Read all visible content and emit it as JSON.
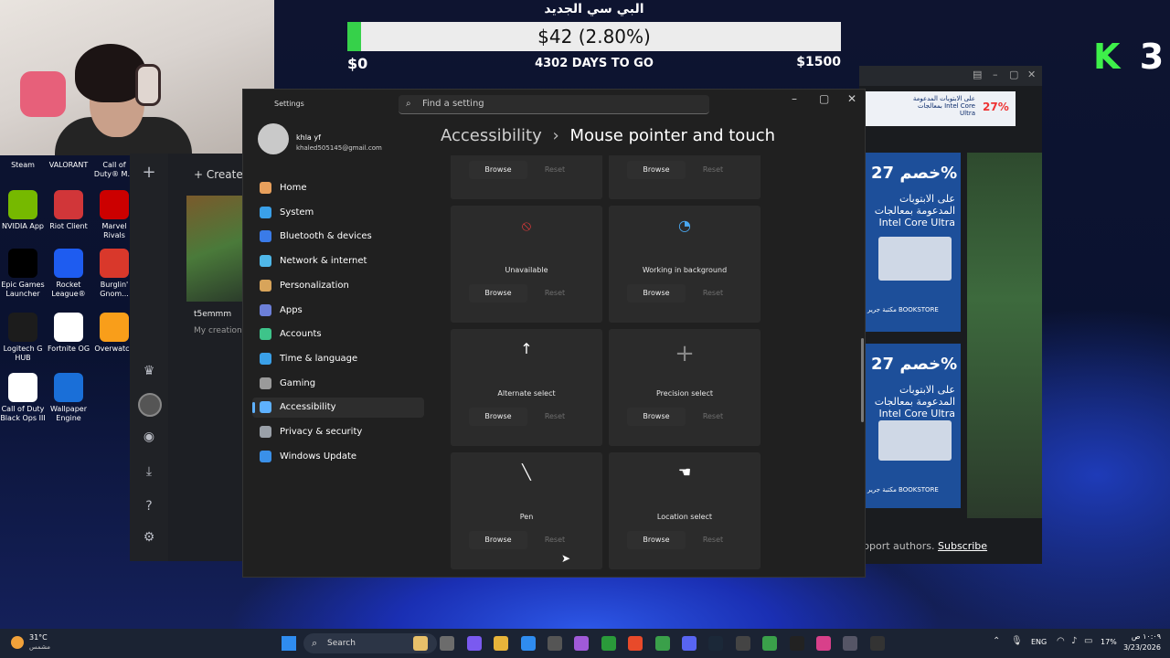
{
  "donation": {
    "title": "البي سي الجديد",
    "amount_text": "$42 (2.80%)",
    "progress_fraction": 0.028,
    "start_label": "$0",
    "days_label": "4302 DAYS TO GO",
    "goal_label": "$1500"
  },
  "brand": {
    "letter": "K",
    "number": "3"
  },
  "desktop_icons": [
    {
      "label": "Steam"
    },
    {
      "label": "VALORANT"
    },
    {
      "label": "Call of Duty® M..."
    },
    {
      "label": "NVIDIA App"
    },
    {
      "label": "Riot Client"
    },
    {
      "label": "Marvel Rivals"
    },
    {
      "label": "Epic Games Launcher"
    },
    {
      "label": "Rocket League®"
    },
    {
      "label": "Burglin' Gnom..."
    },
    {
      "label": "Logitech G HUB"
    },
    {
      "label": "Fortnite OG"
    },
    {
      "label": "Overwatch"
    },
    {
      "label": "Call of Duty Black Ops III"
    },
    {
      "label": "Wallpaper Engine"
    }
  ],
  "launcher": {
    "create_label": "Create",
    "item_title": "t5emmm",
    "item_sub": "My creation"
  },
  "settings": {
    "window_title": "Settings",
    "search_placeholder": "Find a setting",
    "user_name": "khla yf",
    "user_email": "khaled505145@gmail.com",
    "breadcrumb_parent": "Accessibility",
    "breadcrumb_sep": "›",
    "breadcrumb_current": "Mouse pointer and touch",
    "nav": [
      {
        "label": "Home",
        "color": "#e8a05c"
      },
      {
        "label": "System",
        "color": "#3aa0e8"
      },
      {
        "label": "Bluetooth & devices",
        "color": "#3a7be8"
      },
      {
        "label": "Network & internet",
        "color": "#4fb7e8"
      },
      {
        "label": "Personalization",
        "color": "#d8a45a"
      },
      {
        "label": "Apps",
        "color": "#6c7fd8"
      },
      {
        "label": "Accounts",
        "color": "#3ec48a"
      },
      {
        "label": "Time & language",
        "color": "#3aa0e8"
      },
      {
        "label": "Gaming",
        "color": "#9a9a9a"
      },
      {
        "label": "Accessibility",
        "color": "#5eb1ff",
        "active": true
      },
      {
        "label": "Privacy & security",
        "color": "#9aa0a8"
      },
      {
        "label": "Windows Update",
        "color": "#3a90e8"
      }
    ],
    "browse_label": "Browse",
    "reset_label": "Reset",
    "cursor_cards": [
      {
        "label": ""
      },
      {
        "label": ""
      },
      {
        "label": "Unavailable",
        "icon": "unavailable-cursor-icon"
      },
      {
        "label": "Working in background",
        "icon": "working-background-cursor-icon"
      },
      {
        "label": "Alternate select",
        "icon": "alternate-select-cursor-icon"
      },
      {
        "label": "Precision select",
        "icon": "precision-select-cursor-icon"
      },
      {
        "label": "Pen",
        "icon": "pen-cursor-icon"
      },
      {
        "label": "Location select",
        "icon": "location-select-cursor-icon"
      }
    ]
  },
  "browser": {
    "ad1_title": "على الابتوبات المدعومة بمعالجات Intel Core Ultra",
    "ad1_badge": "27%",
    "ad_discount": "خصم 27%",
    "ad_body": "على الابتوبات المدعومة بمعالجات Intel Core Ultra",
    "ad_store": "مكتبة جرير BOOKSTORE",
    "footer_text": "pport authors.",
    "subscribe_label": "Subscribe"
  },
  "taskbar": {
    "weather_temp": "31°C",
    "weather_desc": "مشمس",
    "search_label": "Search",
    "language": "ENG",
    "battery": "17%",
    "time": "١٠:٠٩ ص",
    "date": "3/23/2026"
  }
}
